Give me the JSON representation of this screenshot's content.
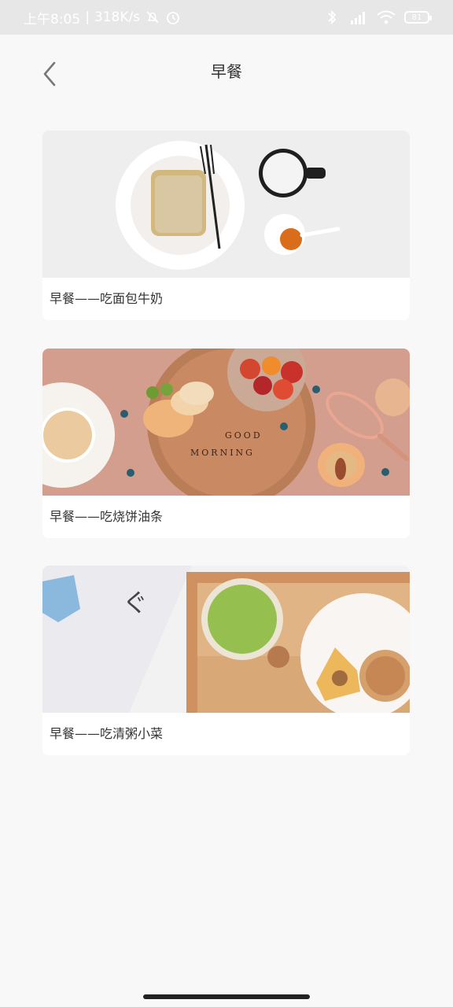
{
  "status_bar": {
    "time": "上午8:05",
    "speed": "318K/s",
    "battery": "81"
  },
  "header": {
    "title": "早餐"
  },
  "cards": [
    {
      "label": "早餐——吃面包牛奶"
    },
    {
      "label": "早餐——吃烧饼油条",
      "image_text_1": "GOOD",
      "image_text_2": "MORNING"
    },
    {
      "label": "早餐——吃清粥小菜",
      "image_text": "ぐ"
    }
  ]
}
